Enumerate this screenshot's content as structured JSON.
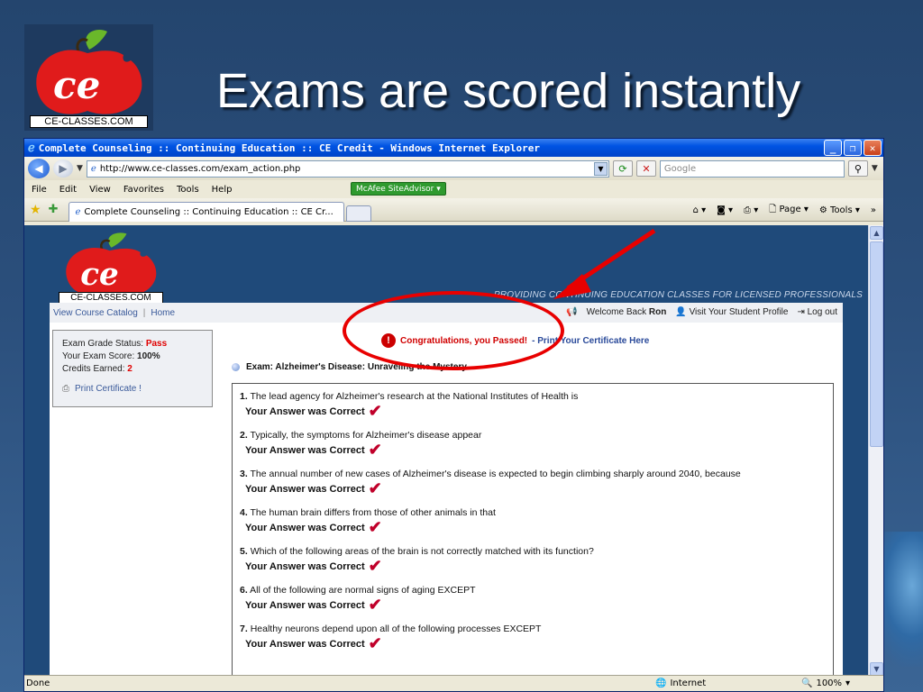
{
  "slide": {
    "title": "Exams are scored instantly",
    "logo_caption": "CE-CLASSES.COM"
  },
  "browser": {
    "window_title": "Complete Counseling :: Continuing Education :: CE Credit - Windows Internet Explorer",
    "url": "http://www.ce-classes.com/exam_action.php",
    "search_placeholder": "Google",
    "menu": [
      "File",
      "Edit",
      "View",
      "Favorites",
      "Tools",
      "Help"
    ],
    "mcafee_label": "McAfee SiteAdvisor",
    "tab_label": "Complete Counseling :: Continuing Education :: CE Cr...",
    "cmd_page": "Page",
    "cmd_tools": "Tools",
    "status_left": "Done",
    "status_zone": "Internet",
    "status_zoom": "100%"
  },
  "site": {
    "logo_caption": "CE-CLASSES.COM",
    "tagline": "PROVIDING CONTINUING EDUCATION CLASSES FOR LICENSED PROFESSIONALS",
    "nav": {
      "catalog": "View Course Catalog",
      "sep": "|",
      "home": "Home"
    },
    "user": {
      "welcome": "Welcome Back",
      "name": "Ron",
      "profile": "Visit Your Student Profile",
      "logout": "Log out"
    },
    "grade": {
      "status_label": "Exam Grade Status:",
      "status_value": "Pass",
      "score_label": "Your Exam Score:",
      "score_value": "100%",
      "credits_label": "Credits Earned:",
      "credits_value": "2",
      "print": "Print Certificate !"
    },
    "congrats": {
      "message": "Congratulations, you Passed!",
      "link": "- Print Your Certificate Here"
    },
    "exam_title": "Exam: Alzheimer's Disease: Unraveling the Mystery",
    "answer_text": "Your Answer was Correct",
    "questions": [
      {
        "num": "1.",
        "text": "The lead agency for Alzheimer's research at the National Institutes of Health is"
      },
      {
        "num": "2.",
        "text": "Typically, the symptoms for Alzheimer's disease appear"
      },
      {
        "num": "3.",
        "text": "The annual number of new cases of Alzheimer's disease is expected to begin climbing sharply around 2040, because"
      },
      {
        "num": "4.",
        "text": "The human brain differs from those of other animals in that"
      },
      {
        "num": "5.",
        "text": "Which of the following areas of the brain is not correctly matched with its function?"
      },
      {
        "num": "6.",
        "text": "All of the following are normal signs of aging EXCEPT"
      },
      {
        "num": "7.",
        "text": "Healthy neurons depend upon all of the following processes EXCEPT"
      }
    ]
  }
}
